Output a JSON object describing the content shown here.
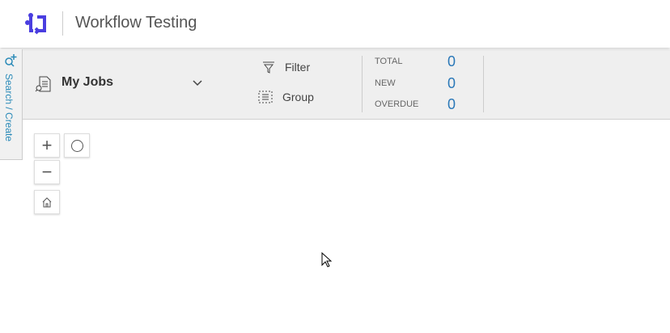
{
  "header": {
    "title": "Workflow Testing"
  },
  "sidebar": {
    "label": "Search / Create"
  },
  "toolbar": {
    "jobs_label": "My Jobs",
    "filter_label": "Filter",
    "group_label": "Group"
  },
  "stats": [
    {
      "label": "TOTAL",
      "value": "0"
    },
    {
      "label": "NEW",
      "value": "0"
    },
    {
      "label": "OVERDUE",
      "value": "0"
    }
  ],
  "colors": {
    "accent": "#2a78b8",
    "logo": "#4a3ee0"
  }
}
